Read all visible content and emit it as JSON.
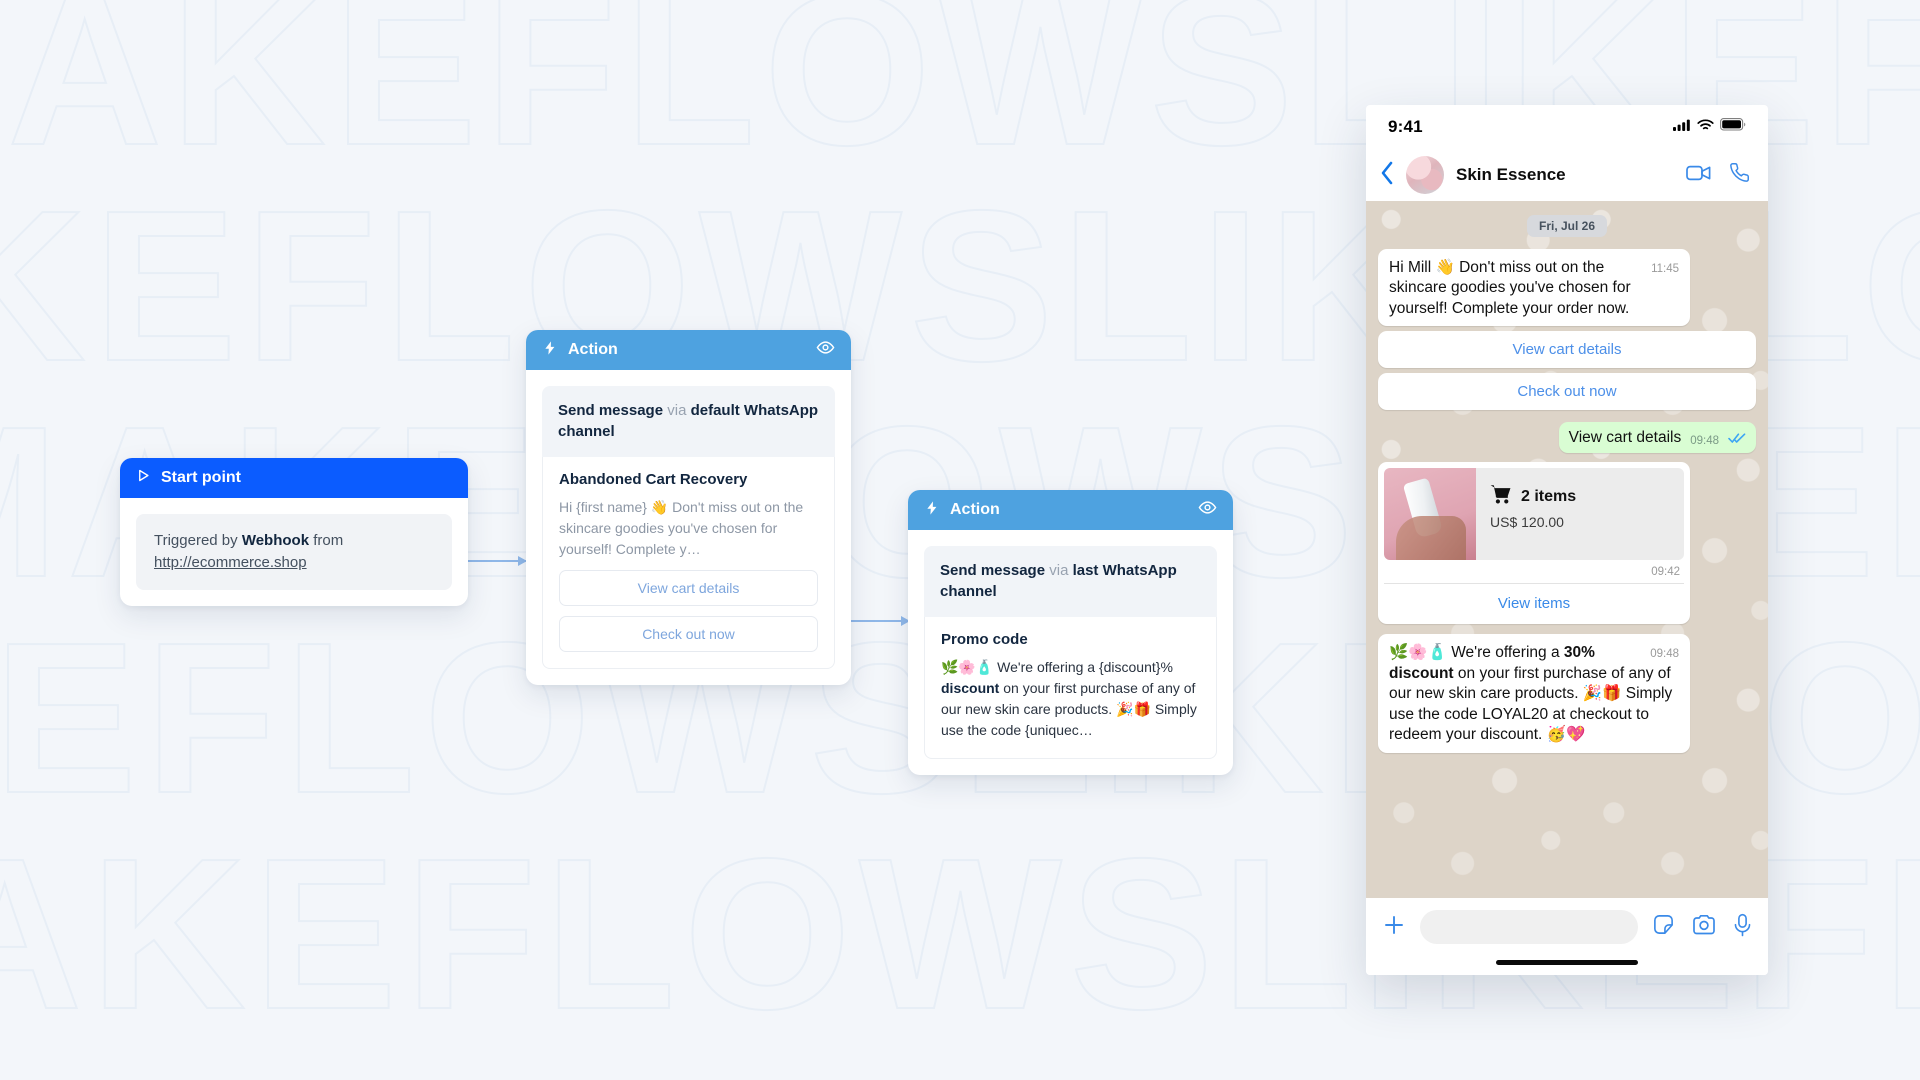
{
  "background": {
    "watermark_text": "MAKEFLOWSLIKEFLOWSMAKEFLOWSLIKEFLOWS"
  },
  "flow": {
    "start_node": {
      "header_label": "Start point",
      "play_icon": "play-icon",
      "trigger_prefix": "Triggered by ",
      "trigger_source": "Webhook",
      "trigger_mid": " from ",
      "trigger_url": "http://ecommerce.shop"
    },
    "action_nodes": [
      {
        "header_label": "Action",
        "bolt_icon": "bolt-icon",
        "eye_icon": "eye-icon",
        "send_prefix": "Send message",
        "send_via": " via ",
        "send_channel": "default WhatsApp channel",
        "message_title": "Abandoned Cart Recovery",
        "message_text": "Hi {first name} 👋 Don't miss out on the skincare goodies you've chosen for yourself! Complete y…",
        "buttons": [
          "View cart details",
          "Check out now"
        ]
      },
      {
        "header_label": "Action",
        "bolt_icon": "bolt-icon",
        "eye_icon": "eye-icon",
        "send_prefix": "Send message",
        "send_via": " via ",
        "send_channel": "last WhatsApp channel",
        "message_title": "Promo code",
        "message_text_a": "🌿🌸🧴 We're offering a {discount}% ",
        "message_text_b": "discount",
        "message_text_c": " on your first purchase of any of our new skin care products. 🎉🎁 Simply use the code {uniquec…",
        "buttons": []
      }
    ]
  },
  "phone": {
    "status_bar": {
      "time": "9:41",
      "cellular_icon": "cellular-signal-icon",
      "wifi_icon": "wifi-icon",
      "battery_icon": "battery-icon"
    },
    "chat_header": {
      "back_icon": "back-chevron-icon",
      "avatar": "contact-avatar",
      "contact_name": "Skin Essence",
      "video_icon": "video-call-icon",
      "phone_icon": "voice-call-icon"
    },
    "conversation": {
      "day_divider": "Fri, Jul 26",
      "incoming_message": {
        "text": "Hi Mill 👋 Don't miss out on the skincare goodies you've chosen for yourself! Complete your order now.",
        "time": "11:45"
      },
      "quick_replies": [
        "View cart details",
        "Check out now"
      ],
      "outgoing_message": {
        "text": "View cart details",
        "time": "09:48",
        "status_icon": "read-receipt-double-check-icon"
      },
      "cart_card": {
        "thumbnail": "product-thumbnail",
        "cart_icon": "shopping-cart-icon",
        "items_label": "2 items",
        "price": "US$ 120.00",
        "time": "09:42",
        "action_label": "View items"
      },
      "promo_message": {
        "text_a": "🌿🌸🧴 We're offering a ",
        "text_b": "30% discount",
        "text_c": " on your first purchase of any of our new skin care products. 🎉🎁 Simply use the code LOYAL20 at checkout to redeem your discount. 🥳💖",
        "time": "09:48"
      }
    },
    "composer": {
      "plus_icon": "add-attachment-icon",
      "input_placeholder": "",
      "sticker_icon": "sticker-icon",
      "camera_icon": "camera-icon",
      "mic_icon": "microphone-icon"
    },
    "home_indicator": "home-indicator"
  },
  "colors": {
    "start_blue": "#0b5cff",
    "action_blue": "#4ea2e0",
    "outgoing_bubble": "#d9fdd3",
    "chat_bg": "#ddd4c8",
    "link_blue": "#3a8ae8"
  }
}
